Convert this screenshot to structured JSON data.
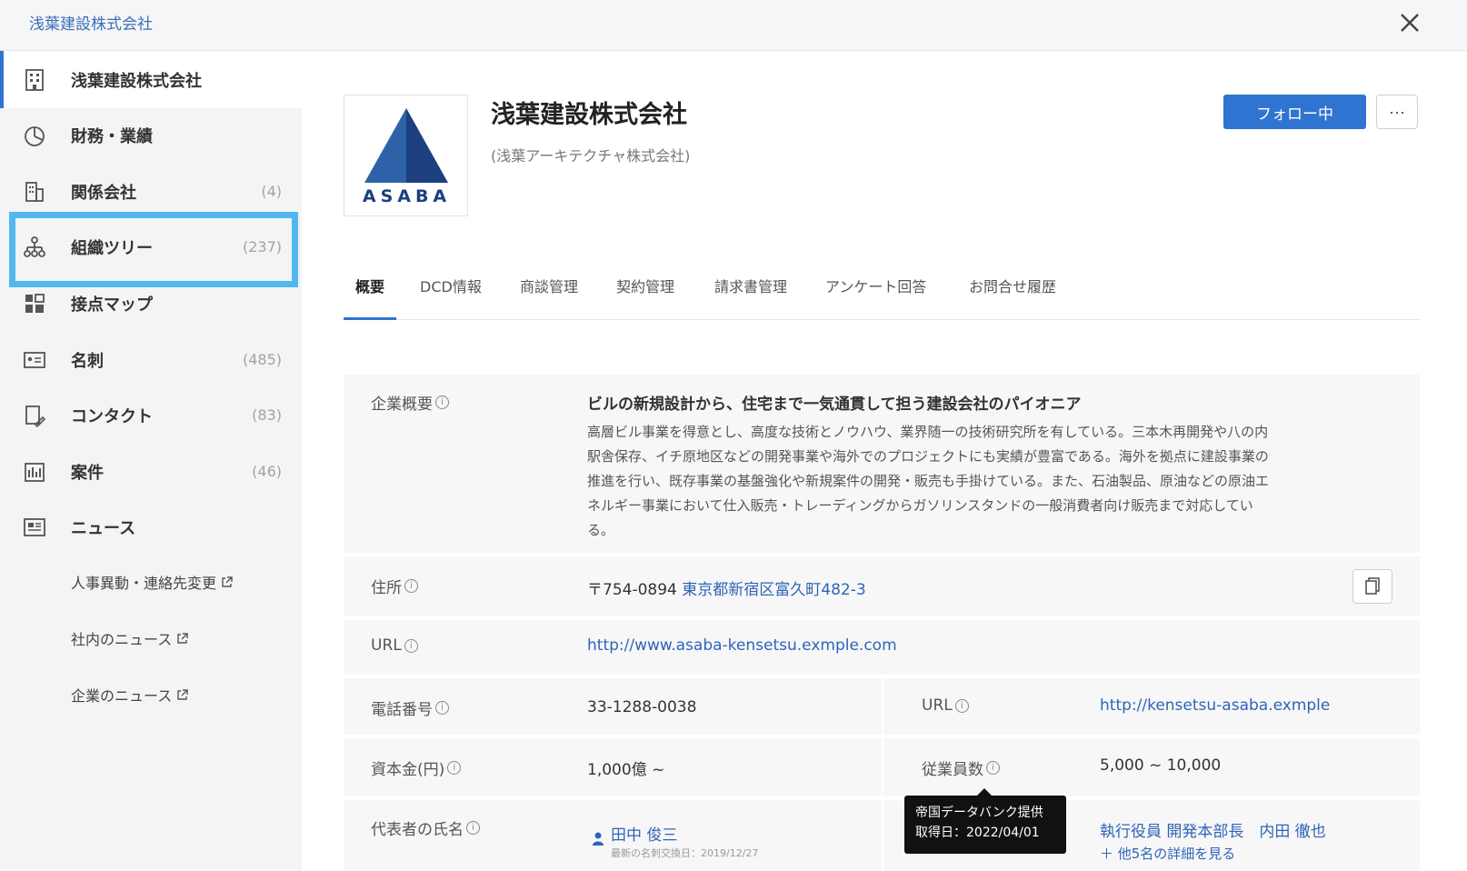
{
  "window": {
    "breadcrumb": "浅葉建設株式会社"
  },
  "sidebar": {
    "items": [
      {
        "label": "浅葉建設株式会社",
        "count": "",
        "icon": "building-icon",
        "active": true
      },
      {
        "label": "財務・業績",
        "count": "",
        "icon": "pie-chart-icon"
      },
      {
        "label": "関係会社",
        "count": "(4)",
        "icon": "buildings-icon"
      },
      {
        "label": "組織ツリー",
        "count": "(237)",
        "icon": "org-tree-icon"
      },
      {
        "label": "接点マップ",
        "count": "",
        "icon": "grid-map-icon"
      },
      {
        "label": "名刺",
        "count": "(485)",
        "icon": "business-card-icon"
      },
      {
        "label": "コンタクト",
        "count": "(83)",
        "icon": "contact-icon"
      },
      {
        "label": "案件",
        "count": "(46)",
        "icon": "deals-icon"
      },
      {
        "label": "ニュース",
        "count": "",
        "icon": "news-icon"
      }
    ],
    "news_sub": [
      {
        "label": "人事異動・連絡先変更",
        "icon": "external-link-icon"
      },
      {
        "label": "社内のニュース",
        "icon": "external-link-icon"
      },
      {
        "label": "企業のニュース",
        "icon": "external-link-icon"
      }
    ]
  },
  "company": {
    "logo_text": "ASABA",
    "name": "浅葉建設株式会社",
    "alias": "(浅葉アーキテクチャ株式会社)",
    "follow_label": "フォロー中",
    "more_label": "···"
  },
  "tabs": [
    "概要",
    "DCD情報",
    "商談管理",
    "契約管理",
    "請求書管理",
    "アンケート回答",
    "お問合せ履歴"
  ],
  "overview": {
    "summary_label": "企業概要",
    "summary_title": "ビルの新規設計から、住宅まで一気通貫して担う建設会社のパイオニア",
    "summary_lines": [
      "高層ビル事業を得意とし、高度な技術とノウハウ、業界随一の技術研究所を有している。三本木再開発や八の内",
      "駅舎保存、イチ原地区などの開発事業や海外でのプロジェクトにも実績が豊富である。海外を拠点に建設事業の",
      "推進を行い、既存事業の基盤強化や新規案件の開発・販売も手掛けている。また、石油製品、原油などの原油エ",
      "ネルギー事業において仕入販売・トレーディングからガソリンスタンドの一般消費者向け販売まで対応してい",
      "る。"
    ],
    "address_label": "住所",
    "postal": "〒754-0894",
    "address": "東京都新宿区富久町482-3",
    "url_label": "URL",
    "url": "http://www.asaba-kensetsu.exmple.com",
    "phone_label": "電話番号",
    "phone": "33-1288-0038",
    "url2_label": "URL",
    "url2": "http://kensetsu-asaba.exmple",
    "capital_label": "資本金(円)",
    "capital": "1,000億 ~",
    "employees_label": "従業員数",
    "employees": "5,000 ~ 10,000",
    "rep_label": "代表者の氏名",
    "rep_name": "田中 俊三",
    "rep_note": "最新の名刺交換日：2019/12/27",
    "exec_text": "執行役員 開発本部長　内田 徹也",
    "exec_more": "＋ 他5名の詳細を見る"
  },
  "tooltip": {
    "line1": "帝国データバンク提供",
    "line2": "取得日：2022/04/01"
  },
  "colors": {
    "accent": "#2f74d0",
    "link": "#2f64b7",
    "highlight": "#4fb9ef"
  }
}
